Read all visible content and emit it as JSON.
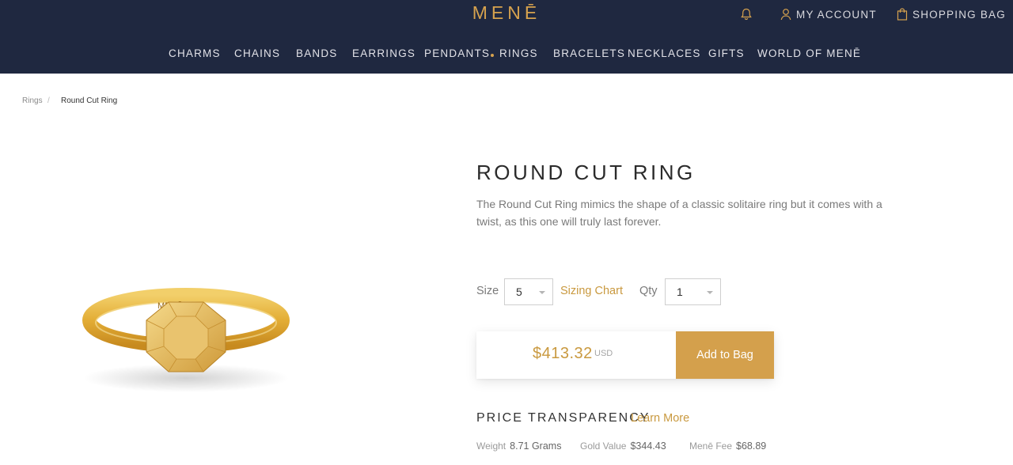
{
  "header": {
    "logo": "MENĒ",
    "account_label": "MY ACCOUNT",
    "bag_label": "SHOPPING BAG",
    "icons": {
      "notification": "bell-icon",
      "account": "user-icon",
      "bag": "shopping-bag-icon"
    }
  },
  "nav": {
    "items": [
      "CHARMS",
      "CHAINS",
      "BANDS",
      "EARRINGS",
      "PENDANTS",
      "RINGS",
      "BRACELETS",
      "NECKLACES",
      "GIFTS",
      "WORLD OF MENĒ"
    ],
    "active": "RINGS"
  },
  "breadcrumb": {
    "items": [
      "Rings",
      "Round Cut Ring"
    ],
    "separator": "/"
  },
  "product": {
    "title": "ROUND CUT RING",
    "description": "The Round Cut Ring mimics the shape of a classic solitaire ring but it comes with a twist, as this one will truly last forever.",
    "ring_engraving": "MENĒ 24K",
    "size_label": "Size",
    "size_value": "5",
    "sizing_chart_label": "Sizing Chart",
    "qty_label": "Qty",
    "qty_value": "1",
    "price": "$413.32",
    "currency": "USD",
    "add_to_bag_label": "Add to Bag"
  },
  "transparency": {
    "title": "PRICE TRANSPARENCY",
    "learn_more_label": "Learn More",
    "weight_label": "Weight",
    "weight_value": "8.71 Grams",
    "gold_label": "Gold Value",
    "gold_value": "$344.43",
    "fee_label": "Menē Fee",
    "fee_value": "$68.89"
  },
  "colors": {
    "navy": "#1f2840",
    "gold": "#d4a04c",
    "gold_text": "#c9993f"
  }
}
